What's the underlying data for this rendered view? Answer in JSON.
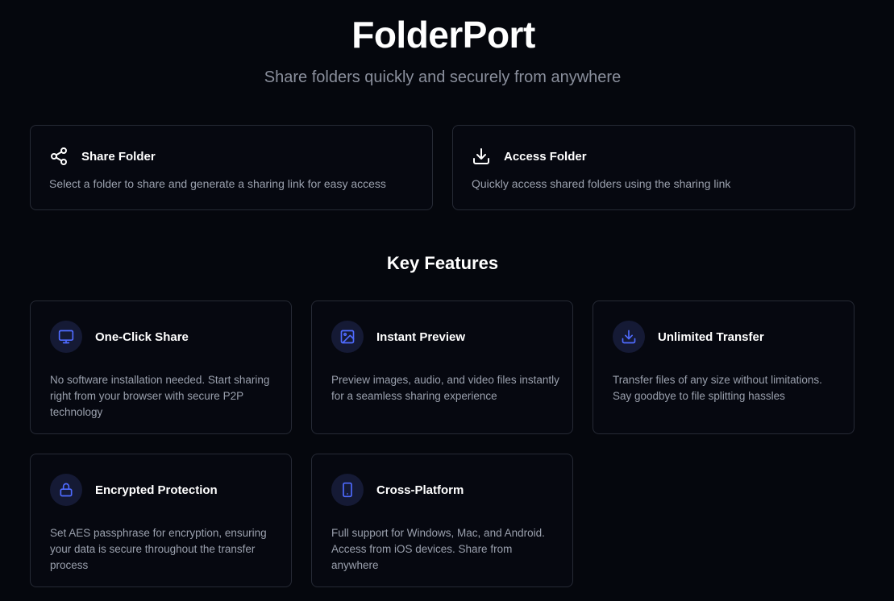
{
  "header": {
    "title": "FolderPort",
    "subtitle": "Share folders quickly and securely from anywhere"
  },
  "actions": [
    {
      "icon": "share-icon",
      "label": "Share Folder",
      "description": "Select a folder to share and generate a sharing link for easy access"
    },
    {
      "icon": "download-icon",
      "label": "Access Folder",
      "description": "Quickly access shared folders using the sharing link"
    }
  ],
  "features_section": {
    "title": "Key Features",
    "items": [
      {
        "icon": "monitor-icon",
        "title": "One-Click Share",
        "description": "No software installation needed. Start sharing right from your browser with secure P2P technology"
      },
      {
        "icon": "image-icon",
        "title": "Instant Preview",
        "description": "Preview images, audio, and video files instantly for a seamless sharing experience"
      },
      {
        "icon": "download-icon",
        "title": "Unlimited Transfer",
        "description": "Transfer files of any size without limitations. Say goodbye to file splitting hassles"
      },
      {
        "icon": "lock-icon",
        "title": "Encrypted Protection",
        "description": "Set AES passphrase for encryption, ensuring your data is secure throughout the transfer process"
      },
      {
        "icon": "smartphone-icon",
        "title": "Cross-Platform",
        "description": "Full support for Windows, Mac, and Android. Access from iOS devices. Share from anywhere"
      }
    ]
  },
  "colors": {
    "background": "#05070d",
    "card_border": "#262a35",
    "accent": "#4f6bff",
    "icon_circle": "#151a35",
    "muted_text": "#9aa0ad"
  }
}
